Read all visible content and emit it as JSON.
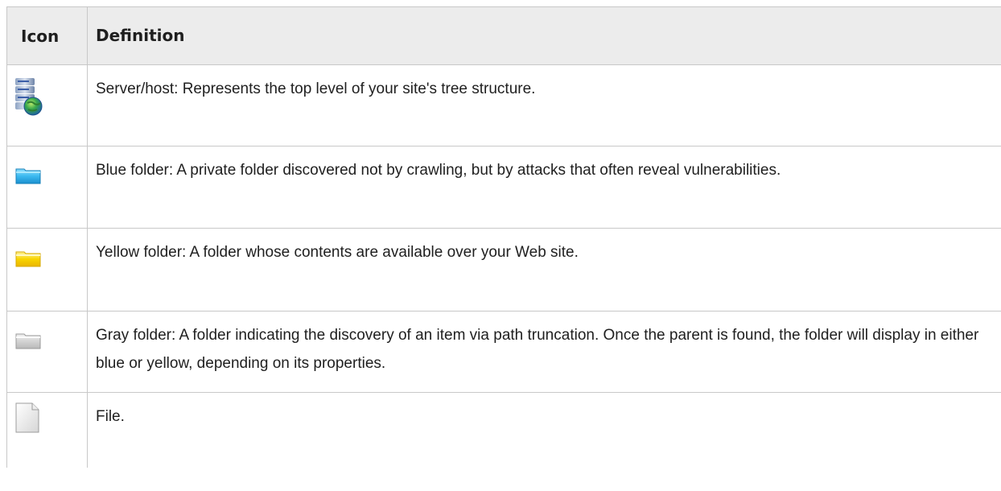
{
  "table": {
    "headers": {
      "icon": "Icon",
      "definition": "Definition"
    },
    "rows": [
      {
        "icon": "server-host-icon",
        "definition": "Server/host: Represents the top level of your site's tree structure."
      },
      {
        "icon": "blue-folder-icon",
        "definition": "Blue folder: A private folder discovered not by crawling, but by attacks that often reveal vulnerabilities."
      },
      {
        "icon": "yellow-folder-icon",
        "definition": "Yellow folder: A folder whose contents are available over your Web site."
      },
      {
        "icon": "gray-folder-icon",
        "definition": "Gray folder: A folder indicating the discovery of an item via path truncation. Once the parent is found, the folder will display in either blue or yellow, depending on its properties."
      },
      {
        "icon": "file-icon",
        "definition": "File."
      }
    ]
  },
  "colors": {
    "header_bg": "#ececec",
    "border": "#c8c8c8",
    "blue_folder": "#2aa9e0",
    "yellow_folder": "#f7d000",
    "gray_folder": "#c9c9c9"
  }
}
